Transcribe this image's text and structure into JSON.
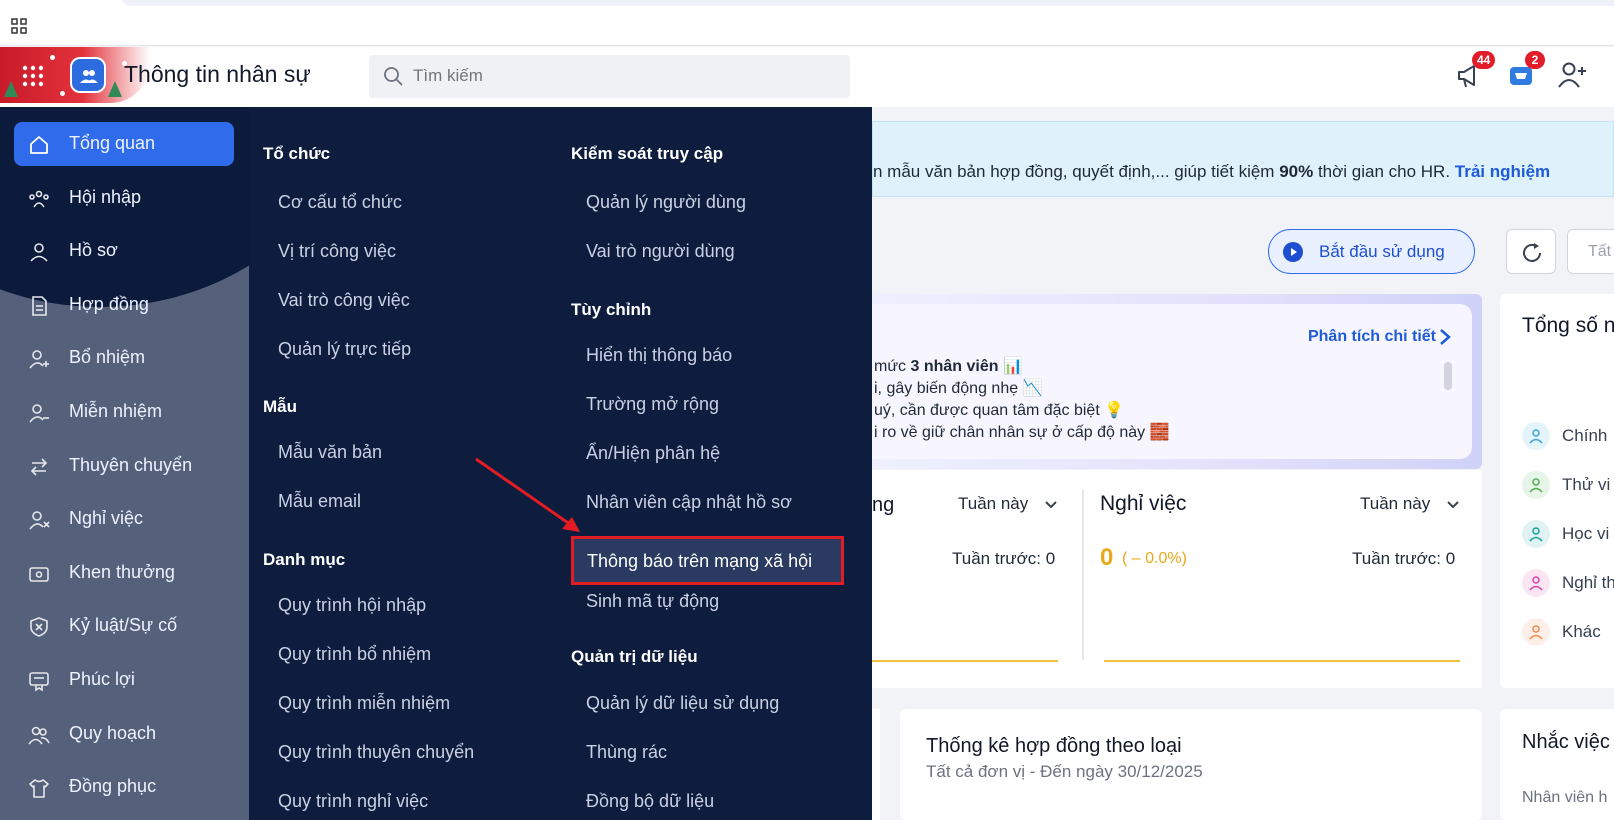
{
  "header": {
    "app_title": "Thông tin nhân sự",
    "search_placeholder": "Tìm kiếm",
    "notifications_badge": "44",
    "cart_badge": "2"
  },
  "sidebar": {
    "items": [
      {
        "label": "Tổng quan",
        "icon": "home-icon",
        "active": true
      },
      {
        "label": "Hội nhập",
        "icon": "people-icon"
      },
      {
        "label": "Hồ sơ",
        "icon": "user-icon"
      },
      {
        "label": "Hợp đồng",
        "icon": "document-icon"
      },
      {
        "label": "Bổ nhiệm",
        "icon": "user-plus-icon"
      },
      {
        "label": "Miễn nhiệm",
        "icon": "user-minus-icon"
      },
      {
        "label": "Thuyên chuyển",
        "icon": "transfer-icon"
      },
      {
        "label": "Nghỉ việc",
        "icon": "user-x-icon"
      },
      {
        "label": "Khen thưởng",
        "icon": "ticket-icon"
      },
      {
        "label": "Kỷ luật/Sự cố",
        "icon": "shield-x-icon"
      },
      {
        "label": "Phúc lợi",
        "icon": "welfare-icon"
      },
      {
        "label": "Quy hoạch",
        "icon": "group-icon"
      },
      {
        "label": "Đồng phục",
        "icon": "shirt-icon"
      }
    ]
  },
  "mega_menu": {
    "col1": {
      "to_chuc": {
        "title": "Tổ chức",
        "items": [
          "Cơ cấu tổ chức",
          "Vị trí công việc",
          "Vai trò công việc",
          "Quản lý trực tiếp"
        ]
      },
      "mau": {
        "title": "Mẫu",
        "items": [
          "Mẫu văn bản",
          "Mẫu email"
        ]
      },
      "danh_muc": {
        "title": "Danh mục",
        "items": [
          "Quy trình hội nhập",
          "Quy trình bổ nhiệm",
          "Quy trình miễn nhiệm",
          "Quy trình thuyên chuyển",
          "Quy trình nghỉ việc"
        ]
      }
    },
    "col2": {
      "kiem_soat": {
        "title": "Kiểm soát truy cập",
        "items": [
          "Quản lý người dùng",
          "Vai trò người dùng"
        ]
      },
      "tuy_chinh": {
        "title": "Tùy chỉnh",
        "items": [
          "Hiển thị thông báo",
          "Trường mở rộng",
          "Ẩn/Hiện phân hệ",
          "Nhân viên cập nhật hồ sơ",
          "Thông báo trên mạng xã hội",
          "Sinh mã tự động"
        ]
      },
      "quan_tri": {
        "title": "Quản trị dữ liệu",
        "items": [
          "Quản lý dữ liệu sử dụng",
          "Thùng rác",
          "Đồng bộ dữ liệu"
        ]
      }
    }
  },
  "banner": {
    "text_before": "n mẫu văn bản hợp đồng, quyết định,... giúp tiết kiệm ",
    "text_bold": "90%",
    "text_after": " thời gian cho HR. ",
    "link": "Trải nghiệm"
  },
  "actions": {
    "start_label": "Bắt đầu sử dụng",
    "filter_text": "Tất"
  },
  "insight": {
    "detail_link": "Phân tích chi tiết",
    "lines": [
      {
        "pre": " mức ",
        "bold": "3 nhân viên",
        "post": " 📊"
      },
      {
        "pre": "i, gây biến động nhẹ 📉",
        "bold": "",
        "post": ""
      },
      {
        "pre": "uý, cần được quan tâm đặc biệt 💡",
        "bold": "",
        "post": ""
      },
      {
        "pre": "i ro về giữ chân nhân sự ở cấp độ này 🧱",
        "bold": "",
        "post": ""
      }
    ]
  },
  "stats": {
    "left_title_fragment": "ng",
    "left_period": "Tuần này",
    "left_prev": "Tuần trước: 0",
    "right_title": "Nghỉ việc",
    "right_period": "Tuần này",
    "right_value": "0",
    "right_pct": "( – 0.0%)",
    "right_prev": "Tuần trước: 0"
  },
  "right_card": {
    "title": "Tổng số n",
    "rows": [
      {
        "label": "Chính",
        "color": "#3aa6d9"
      },
      {
        "label": "Thử vi",
        "color": "#4caf50"
      },
      {
        "label": "Học vi",
        "color": "#1aa39a"
      },
      {
        "label": "Nghỉ th",
        "color": "#d946a8"
      },
      {
        "label": "Khác",
        "color": "#f08a4b"
      }
    ]
  },
  "contract_card": {
    "title": "Thống kê hợp đồng theo loại",
    "subtitle": "Tất cả đơn vị - Đến ngày 30/12/2025"
  },
  "remind_card": {
    "title": "Nhắc việc",
    "subtitle": "Nhân viên h"
  },
  "colors": {
    "accent": "#2f6bea",
    "sidebar_navy": "#0c1b3b",
    "highlight_border": "#e31b23",
    "badge_red": "#e11d2a",
    "warning_yellow": "#e8a817"
  }
}
